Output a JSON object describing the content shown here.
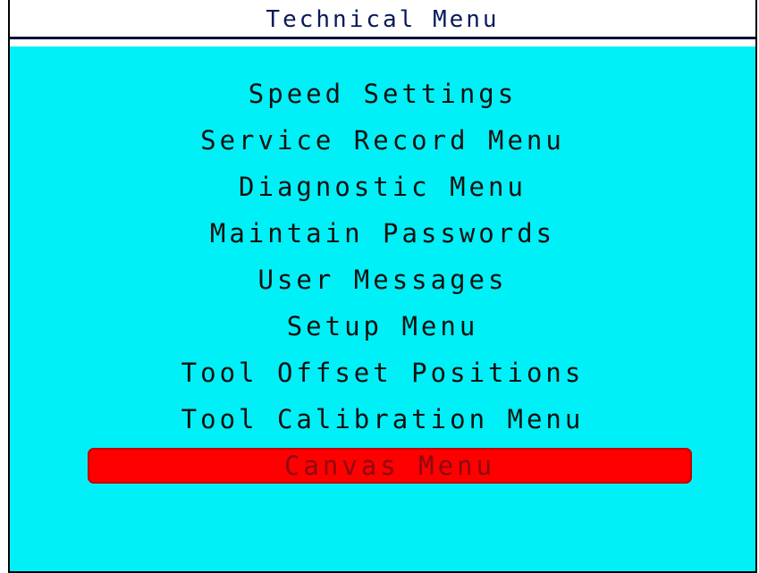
{
  "title": "Technical Menu",
  "colors": {
    "title_text": "#0a1a5a",
    "menu_background": "#00f0f7",
    "item_text": "#111111",
    "selected_background": "#ff0000",
    "selected_text": "#8a0b10"
  },
  "menu": {
    "items": [
      {
        "label": "Speed Settings"
      },
      {
        "label": "Service Record Menu"
      },
      {
        "label": "Diagnostic Menu"
      },
      {
        "label": "Maintain Passwords"
      },
      {
        "label": "User Messages"
      },
      {
        "label": "Setup Menu"
      },
      {
        "label": "Tool Offset Positions"
      },
      {
        "label": "Tool Calibration Menu"
      },
      {
        "label": "Canvas Menu",
        "selected": true
      }
    ]
  }
}
